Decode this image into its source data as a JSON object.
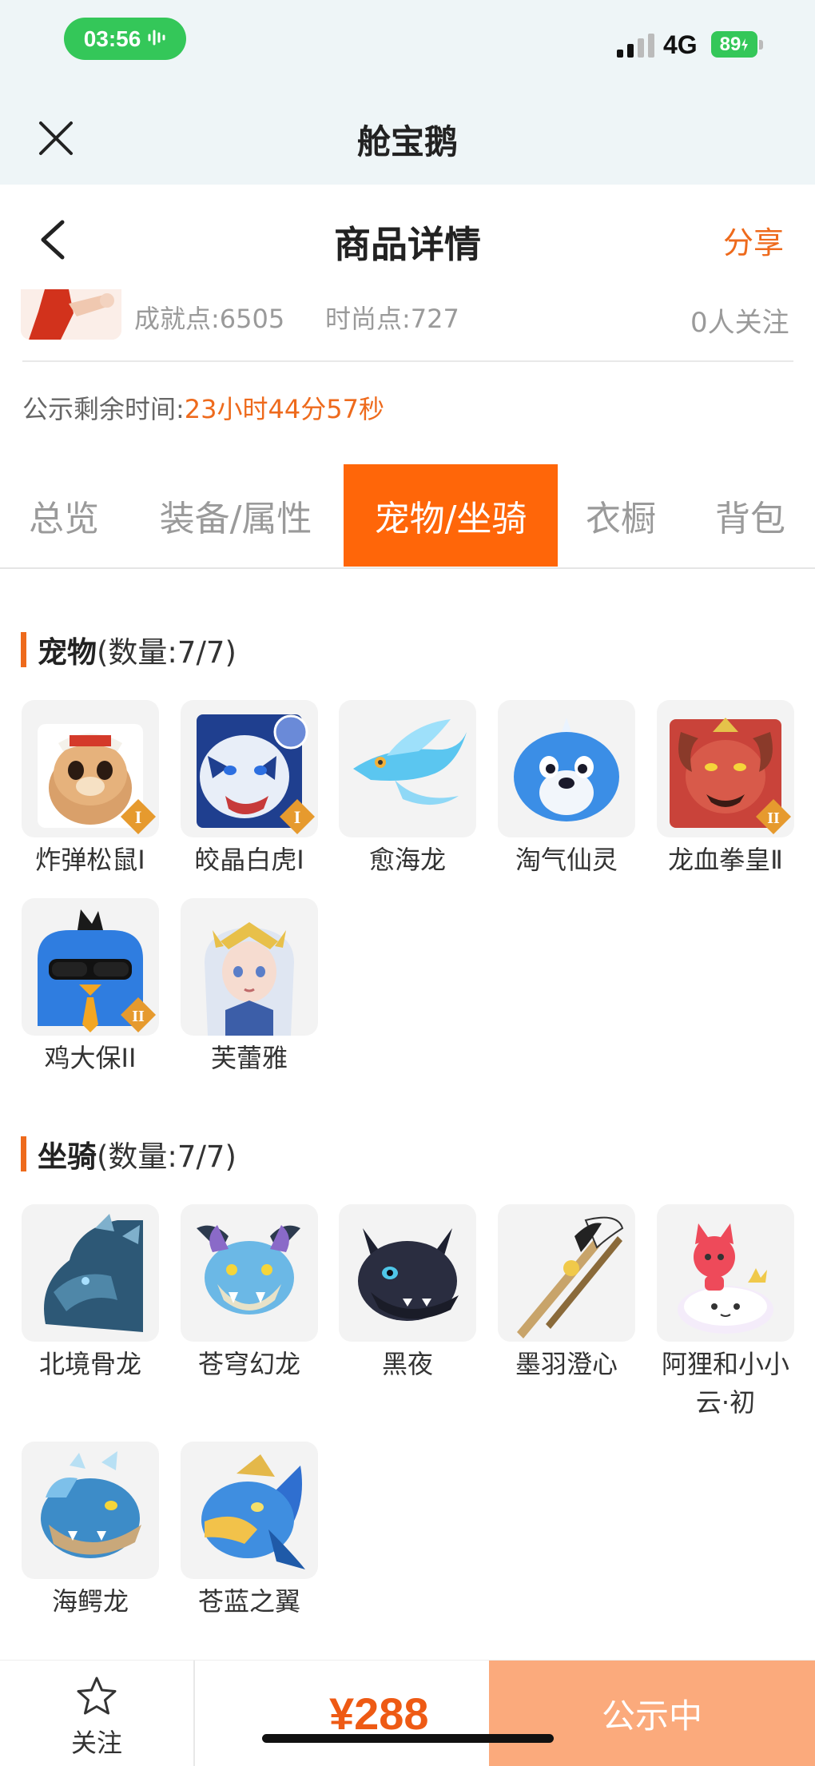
{
  "status_bar": {
    "time": "03:56",
    "network": "4G",
    "battery": "89"
  },
  "app": {
    "title": "舱宝鹅"
  },
  "header": {
    "title": "商品详情",
    "share_label": "分享"
  },
  "profile": {
    "achievement": "成就点:6505",
    "fashion": "时尚点:727",
    "followers": "0人关注"
  },
  "publicity": {
    "label": "公示剩余时间:",
    "value": "23小时44分57秒"
  },
  "tabs": [
    {
      "label": "总览",
      "active": false
    },
    {
      "label": "装备/属性",
      "active": false
    },
    {
      "label": "宠物/坐骑",
      "active": true
    },
    {
      "label": "衣橱",
      "active": false
    },
    {
      "label": "背包",
      "active": false
    }
  ],
  "pets": {
    "title": "宠物",
    "count": "(数量:7/7)",
    "items": [
      {
        "name": "炸弹松鼠Ⅰ",
        "icon": "squirrel-pet-icon",
        "badge": "I"
      },
      {
        "name": "皎晶白虎Ⅰ",
        "icon": "white-tiger-pet-icon",
        "badge": "I"
      },
      {
        "name": "愈海龙",
        "icon": "sea-dragon-pet-icon",
        "badge": ""
      },
      {
        "name": "淘气仙灵",
        "icon": "blue-spirit-pet-icon",
        "badge": ""
      },
      {
        "name": "龙血拳皇Ⅱ",
        "icon": "red-dragon-boxer-pet-icon",
        "badge": "II"
      },
      {
        "name": "鸡大保II",
        "icon": "blue-bird-pet-icon",
        "badge": "II"
      },
      {
        "name": "芙蕾雅",
        "icon": "freya-pet-icon",
        "badge": ""
      }
    ]
  },
  "mounts": {
    "title": "坐骑",
    "count": "(数量:7/7)",
    "items": [
      {
        "name": "北境骨龙",
        "icon": "bone-dragon-mount-icon"
      },
      {
        "name": "苍穹幻龙",
        "icon": "sky-dragon-mount-icon"
      },
      {
        "name": "黑夜",
        "icon": "black-dragon-mount-icon"
      },
      {
        "name": "墨羽澄心",
        "icon": "feather-sword-mount-icon"
      },
      {
        "name": "阿狸和小小云·初",
        "icon": "ali-cloud-mount-icon"
      },
      {
        "name": "海鳄龙",
        "icon": "sea-croc-dragon-mount-icon"
      },
      {
        "name": "苍蓝之翼",
        "icon": "azure-wing-mount-icon"
      }
    ]
  },
  "bottom_bar": {
    "follow_label": "关注",
    "price": "¥288",
    "status_label": "公示中"
  },
  "colors": {
    "accent": "#ff6609",
    "price": "#ee5a14",
    "status_button": "#fbaa7c"
  }
}
